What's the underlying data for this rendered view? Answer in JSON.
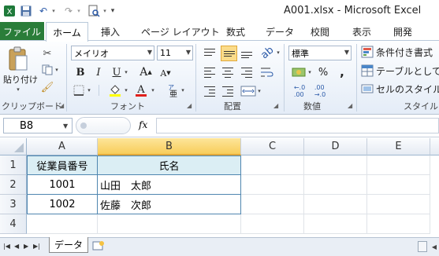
{
  "window": {
    "title": "A001.xlsx - Microsoft Excel",
    "qat": [
      "excel-logo",
      "save",
      "undo",
      "redo",
      "print-preview",
      "customize"
    ]
  },
  "ribbon": {
    "file_tab": "ファイル",
    "tabs": [
      "ホーム",
      "挿入",
      "ページ レイアウト",
      "数式",
      "データ",
      "校閲",
      "表示",
      "開発"
    ],
    "active_tab": "ホーム",
    "clipboard": {
      "paste": "貼り付け",
      "label": "クリップボード"
    },
    "font": {
      "name": "メイリオ",
      "size": "11",
      "label": "フォント",
      "bold": "B",
      "italic": "I",
      "underline": "U",
      "grow": "A",
      "shrink": "A"
    },
    "alignment": {
      "label": "配置"
    },
    "number": {
      "format": "標準",
      "label": "数値",
      "percent": "%",
      "comma": ","
    },
    "styles": {
      "conditional": "条件付き書式",
      "table": "テーブルとして書式",
      "cell_styles": "セルのスタイル",
      "label": "スタイル"
    },
    "accent": "#2a7d39"
  },
  "formula_bar": {
    "name_box": "B8",
    "fx": "fx",
    "content": ""
  },
  "grid": {
    "columns": [
      "A",
      "B",
      "C",
      "D",
      "E"
    ],
    "selected_column": "B",
    "rows": [
      "1",
      "2",
      "3",
      "4"
    ],
    "cells": [
      [
        "従業員番号",
        "氏名"
      ],
      [
        "1001",
        "山田　太郎"
      ],
      [
        "1002",
        "佐藤　次郎"
      ]
    ]
  },
  "sheets": {
    "tabs": [
      "データ"
    ],
    "active": "データ"
  }
}
